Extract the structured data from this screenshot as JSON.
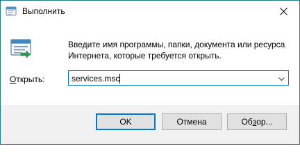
{
  "window": {
    "title": "Выполнить",
    "app_icon": "run-dialog-icon",
    "close_icon": "close-icon"
  },
  "content": {
    "run_icon": "run-program-icon",
    "description": "Введите имя программы, папки, документа или ресурса Интернета, которые требуется открыть.",
    "open_label_accel": "О",
    "open_label_rest": "ткрыть:",
    "combo_value": "services.msc",
    "combo_arrow_icon": "chevron-down-icon"
  },
  "buttons": {
    "ok": "OK",
    "cancel": "Отмена",
    "browse_prefix": "Об",
    "browse_accel": "з",
    "browse_suffix": "ор..."
  },
  "colors": {
    "accent": "#0078d7",
    "window_border": "#1a7f8f",
    "footer_bg": "#f0f0f0",
    "button_bg": "#e1e1e1"
  }
}
